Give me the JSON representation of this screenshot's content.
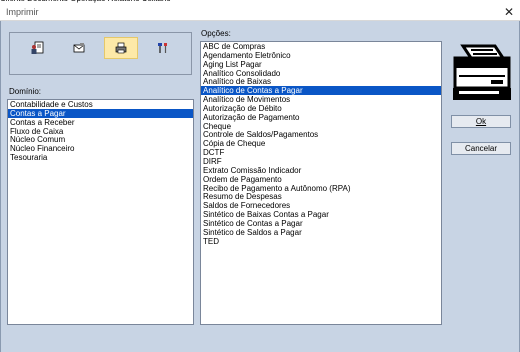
{
  "window": {
    "title": "Imprimir",
    "close_glyph": "✕"
  },
  "background_menu": [
    "Cliente",
    "Documento",
    "Operação",
    "Relatório",
    "Utilitário"
  ],
  "icons": [
    {
      "name": "person-document-icon",
      "active": false
    },
    {
      "name": "envelope-document-icon",
      "active": false
    },
    {
      "name": "printer-small-icon",
      "active": true
    },
    {
      "name": "tools-icon",
      "active": false
    }
  ],
  "dominio": {
    "label": "Domínio:",
    "items": [
      "Contabilidade e Custos",
      "Contas a Pagar",
      "Contas a Receber",
      "Fluxo de Caixa",
      "Núcleo Comum",
      "Núcleo Financeiro",
      "Tesouraria"
    ],
    "selected": "Contas a Pagar"
  },
  "opcoes": {
    "label": "Opções:",
    "items": [
      "ABC de Compras",
      "Agendamento Eletrônico",
      "Aging List Pagar",
      "Analítico Consolidado",
      "Analítico de Baixas",
      "Analítico de Contas a Pagar",
      "Analítico de Movimentos",
      "Autorização de Débito",
      "Autorização de Pagamento",
      "Cheque",
      "Controle de Saldos/Pagamentos",
      "Cópia de Cheque",
      "DCTF",
      "DIRF",
      "Extrato Comissão Indicador",
      "Ordem de Pagamento",
      "Recibo de Pagamento a Autônomo (RPA)",
      "Resumo de Despesas",
      "Saldos de Fornecedores",
      "Sintético de Baixas Contas a Pagar",
      "Sintético de Contas a Pagar",
      "Sintético de Saldos a Pagar",
      "TED"
    ],
    "selected": "Analítico de Contas a Pagar"
  },
  "buttons": {
    "ok_label": "Ok",
    "cancel_label": "Cancelar"
  },
  "colors": {
    "selection": "#0a56c6",
    "active_icon_bg": "#fde9a8",
    "dialog_bg": "#c8d4e4"
  }
}
